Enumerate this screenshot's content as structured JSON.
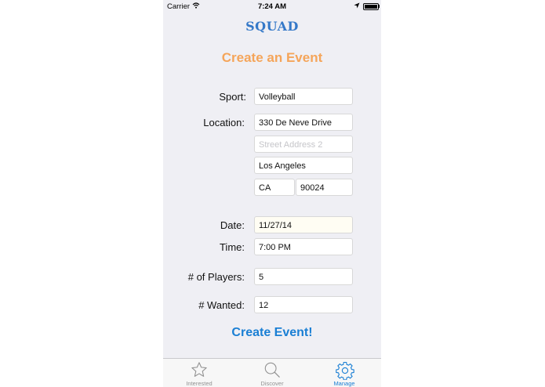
{
  "status_bar": {
    "carrier": "Carrier",
    "time": "7:24 AM"
  },
  "app_title": "SQUAD",
  "page_heading": "Create an Event",
  "form": {
    "sport_label": "Sport:",
    "sport_value": "Volleyball",
    "location_label": "Location:",
    "address1_value": "330 De Neve Drive",
    "address2_placeholder": "Street Address 2",
    "city_value": "Los Angeles",
    "state_value": "CA",
    "zip_value": "90024",
    "date_label": "Date:",
    "date_value": "11/27/14",
    "time_label": "Time:",
    "time_value": "7:00 PM",
    "players_label": "# of Players:",
    "players_value": "5",
    "wanted_label": "# Wanted:",
    "wanted_value": "12"
  },
  "create_button": "Create Event!",
  "tabs": [
    {
      "label": "Interested",
      "icon": "star-icon",
      "active": false
    },
    {
      "label": "Discover",
      "icon": "search-icon",
      "active": false
    },
    {
      "label": "Manage",
      "icon": "gear-icon",
      "active": true
    }
  ],
  "colors": {
    "title": "#3478c8",
    "heading": "#f5a55a",
    "accent": "#1a7fd4",
    "inactive_tab": "#929292"
  }
}
